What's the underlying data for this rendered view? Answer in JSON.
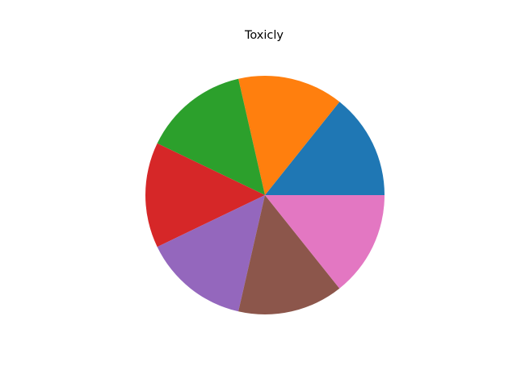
{
  "chart_data": {
    "type": "pie",
    "title": "Toxicly",
    "values": [
      1,
      1,
      1,
      1,
      1,
      1,
      1
    ],
    "colors": [
      "#1f77b4",
      "#ff7f0e",
      "#2ca02c",
      "#d62728",
      "#9467bd",
      "#8c564b",
      "#e377c2"
    ],
    "start_angle_deg": 0,
    "direction": "counterclockwise"
  }
}
